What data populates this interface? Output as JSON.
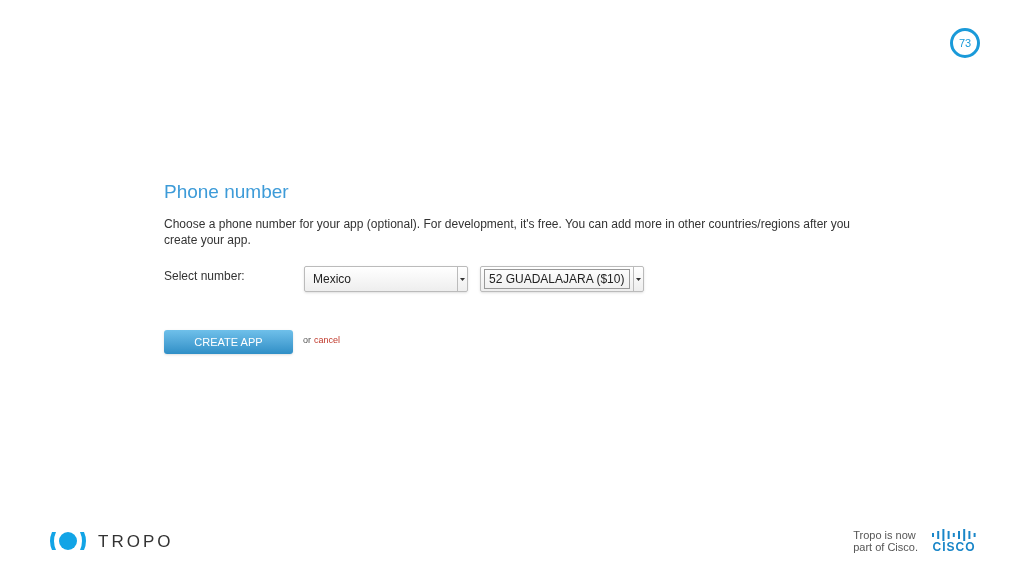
{
  "page_number": "73",
  "form": {
    "title": "Phone number",
    "description": "Choose a phone number for your app (optional). For development, it's free. You can add more in other countries/regions after you create your app.",
    "select_label": "Select number:",
    "selects": [
      {
        "value": "Mexico",
        "focused": false
      },
      {
        "value": "52 GUADALAJARA ($10)",
        "focused": true
      }
    ],
    "create_button": "CREATE APP",
    "or_text": "or",
    "cancel_link": "cancel"
  },
  "footer": {
    "logo_text": "TROPO",
    "note_lines": [
      "Tropo is now",
      "part of Cisco."
    ],
    "partner_logo_text": "CISCO"
  }
}
